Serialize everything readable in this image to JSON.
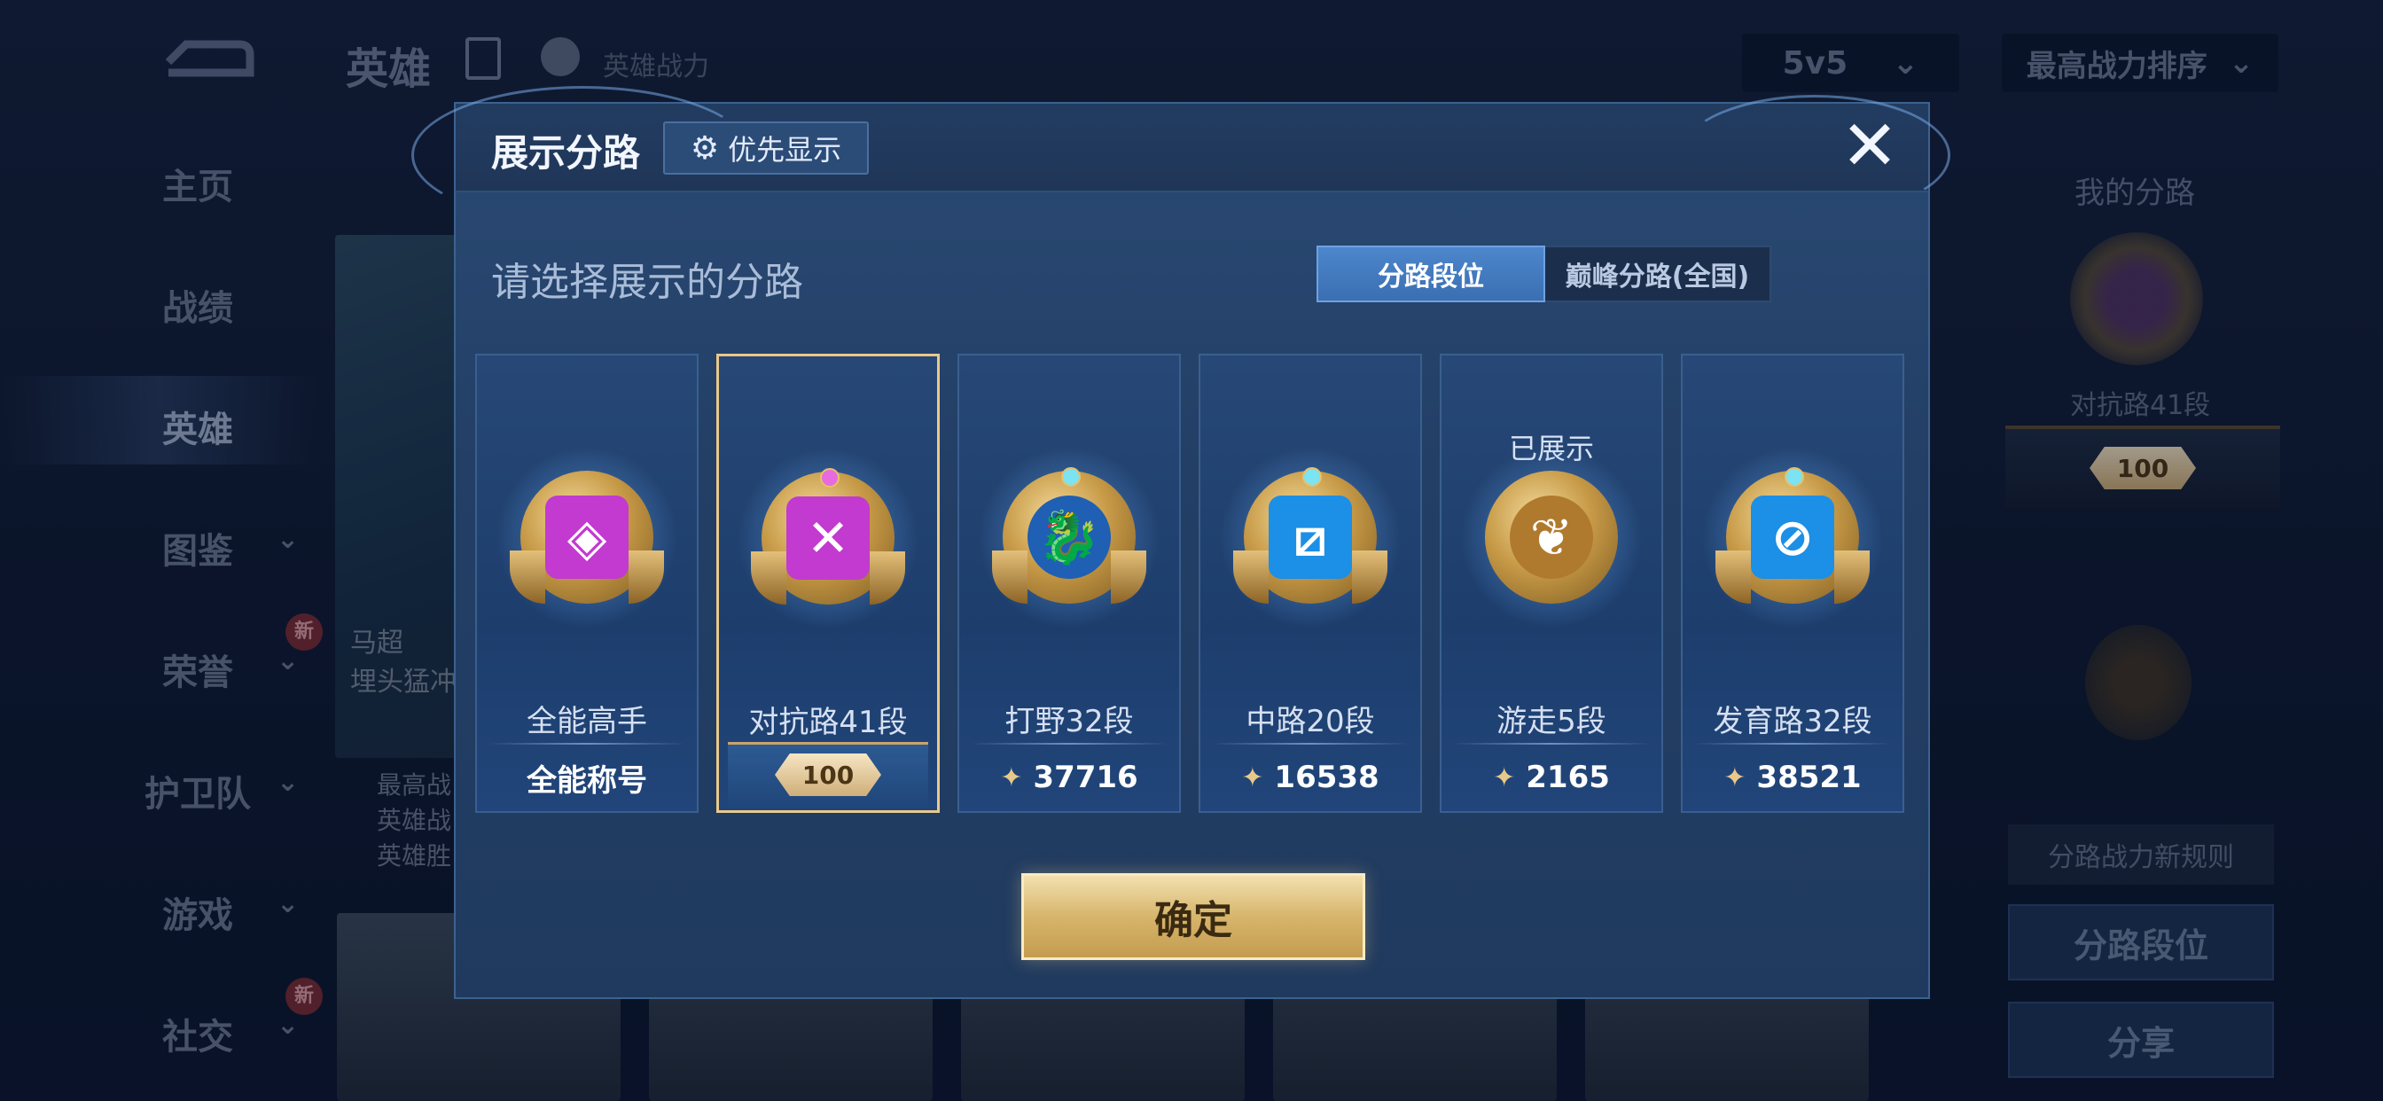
{
  "background": {
    "page_title": "英雄",
    "power_label": "英雄战力",
    "mode_select": "5v5",
    "sort_select": "最高战力排序",
    "sidebar": [
      {
        "label": "主页",
        "chevron": false,
        "badge": ""
      },
      {
        "label": "战绩",
        "chevron": false,
        "badge": ""
      },
      {
        "label": "英雄",
        "chevron": false,
        "badge": "",
        "active": true
      },
      {
        "label": "图鉴",
        "chevron": true,
        "badge": ""
      },
      {
        "label": "荣誉",
        "chevron": true,
        "badge": "新"
      },
      {
        "label": "护卫队",
        "chevron": true,
        "badge": ""
      },
      {
        "label": "游戏",
        "chevron": true,
        "badge": ""
      },
      {
        "label": "社交",
        "chevron": true,
        "badge": "新"
      }
    ],
    "hero_card": {
      "line1": "马超",
      "line2": "埋头猛冲"
    },
    "hero_stats": [
      "最高战",
      "英雄战",
      "英雄胜"
    ],
    "right_panel": {
      "title": "我的分路",
      "lane": "对抗路41段",
      "star_value": "100",
      "rule_button": "分路战力新规则",
      "lane_rank_button": "分路段位",
      "share_button": "分享"
    }
  },
  "modal": {
    "title": "展示分路",
    "pref_button": "优先显示",
    "close_glyph": "✕",
    "prompt": "请选择展示的分路",
    "tabs": [
      {
        "label": "分路段位",
        "active": true
      },
      {
        "label": "巅峰分路(全国)",
        "active": false
      }
    ],
    "cards": [
      {
        "lane": "全能高手",
        "sub": "全能称号",
        "shown": "",
        "glyph": "◈",
        "core_color": "#c23ad0",
        "selected": false,
        "power": false
      },
      {
        "lane": "对抗路41段",
        "sub": "",
        "star": "100",
        "shown": "",
        "glyph": "✕",
        "core_color": "#c23ad0",
        "selected": true,
        "power": false
      },
      {
        "lane": "打野32段",
        "sub": "37716",
        "shown": "",
        "glyph": "🐉",
        "core_color": "#1f5fb4",
        "selected": false,
        "power": true
      },
      {
        "lane": "中路20段",
        "sub": "16538",
        "shown": "",
        "glyph": "⧄",
        "core_color": "#1c8fe6",
        "selected": false,
        "power": true
      },
      {
        "lane": "游走5段",
        "sub": "2165",
        "shown": "已展示",
        "glyph": "❦",
        "core_color": "#b07a2e",
        "selected": false,
        "power": true
      },
      {
        "lane": "发育路32段",
        "sub": "38521",
        "shown": "",
        "glyph": "⊘",
        "core_color": "#1c8fe6",
        "selected": false,
        "power": true
      }
    ],
    "confirm_button": "确定"
  }
}
